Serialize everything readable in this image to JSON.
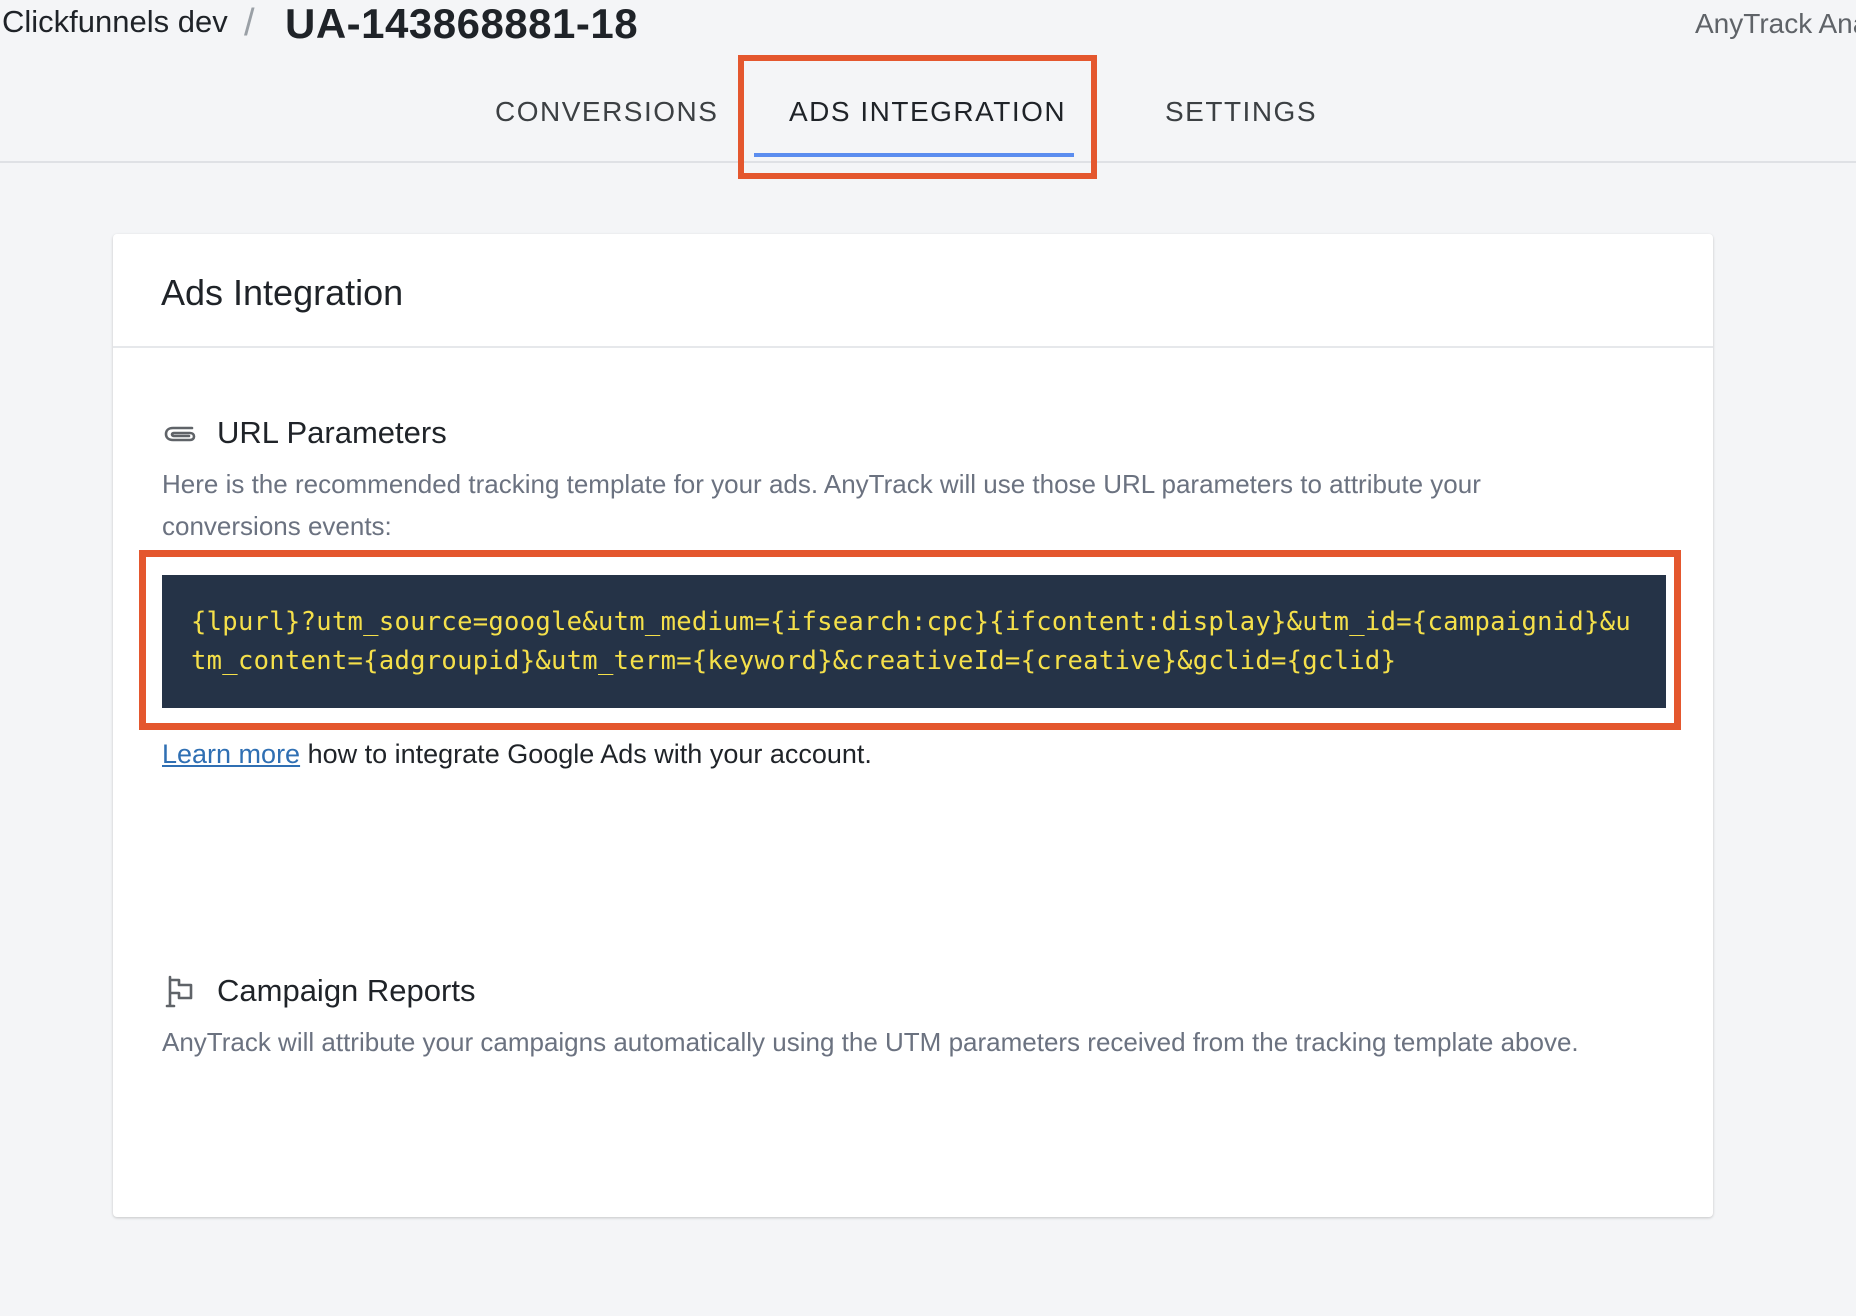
{
  "header": {
    "project": "Clickfunnels dev",
    "separator": "/",
    "property_id": "UA-143868881-18",
    "brand": "AnyTrack Analytics"
  },
  "tabs": [
    {
      "label": "CONVERSIONS",
      "active": false
    },
    {
      "label": "ADS INTEGRATION",
      "active": true
    },
    {
      "label": "SETTINGS",
      "active": false
    }
  ],
  "card": {
    "title": "Ads Integration",
    "url_parameters": {
      "icon": "paperclip-icon",
      "title": "URL Parameters",
      "description": "Here is the recommended tracking template for your ads. AnyTrack will use those URL parameters to attribute your conversions events:",
      "template": "{lpurl}?utm_source=google&utm_medium={ifsearch:cpc}{ifcontent:display}&utm_id={campaignid}&utm_content={adgroupid}&utm_term={keyword}&creativeId={creative}&gclid={gclid}",
      "learn_more_link": "Learn more",
      "learn_more_text": " how to integrate Google Ads with your account."
    },
    "campaign_reports": {
      "icon": "flag-icon",
      "title": "Campaign Reports",
      "description": "AnyTrack will attribute your campaigns automatically using the UTM parameters received from the tracking template above."
    }
  },
  "colors": {
    "highlight": "#e4572e",
    "tab_underline": "#5b8def",
    "code_bg": "#253347",
    "code_text": "#f5e04a",
    "link": "#2f6fb3"
  }
}
